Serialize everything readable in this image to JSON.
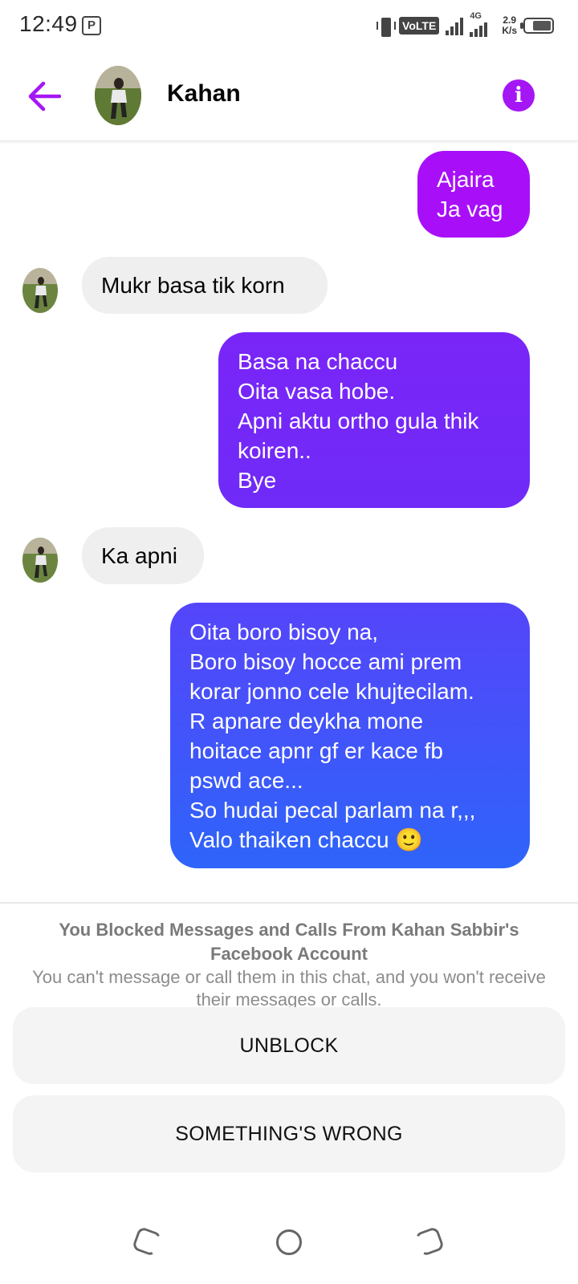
{
  "status_bar": {
    "time": "12:49",
    "volte": "VoLTE",
    "network_type": "4G",
    "speed_value": "2.9",
    "speed_unit": "K/s"
  },
  "header": {
    "contact_name": "Kahan",
    "back_icon": "arrow-left-icon",
    "info_icon": "info-icon"
  },
  "colors": {
    "accent": "#a516f5",
    "incoming_bubble": "#efefef",
    "bubble_1": "#a80ff8",
    "bubble_2_top": "#7a25f8",
    "bubble_2_bottom": "#6f2bf8",
    "bubble_3_top": "#5545fa",
    "bubble_3_bottom": "#2e64fa"
  },
  "messages": [
    {
      "direction": "outgoing",
      "lines": [
        "Ajaira",
        "Ja vag"
      ]
    },
    {
      "direction": "incoming",
      "lines": [
        "Mukr basa tik korn"
      ]
    },
    {
      "direction": "outgoing",
      "lines": [
        "Basa na chaccu",
        "Oita vasa hobe.",
        "Apni aktu ortho gula thik",
        "koiren..",
        "Bye"
      ]
    },
    {
      "direction": "incoming",
      "lines": [
        "Ka apni"
      ]
    },
    {
      "direction": "outgoing",
      "lines": [
        "Oita boro bisoy na,",
        "Boro bisoy hocce ami prem",
        "korar jonno cele khujtecilam.",
        "R apnare deykha mone",
        "hoitace apnr gf er kace fb",
        "pswd ace...",
        "So hudai pecal parlam na r,,,",
        "Valo thaiken chaccu 🙂"
      ]
    }
  ],
  "block_notice": {
    "title": "You Blocked Messages and Calls From Kahan Sabbir's Facebook Account",
    "description": "You can't message or call them in this chat, and you won't receive their messages or calls."
  },
  "actions": {
    "unblock_label": "UNBLOCK",
    "something_wrong_label": "SOMETHING'S WRONG"
  },
  "nav": {
    "recent_icon": "recent-apps-icon",
    "home_icon": "home-icon",
    "back_icon": "back-icon"
  }
}
